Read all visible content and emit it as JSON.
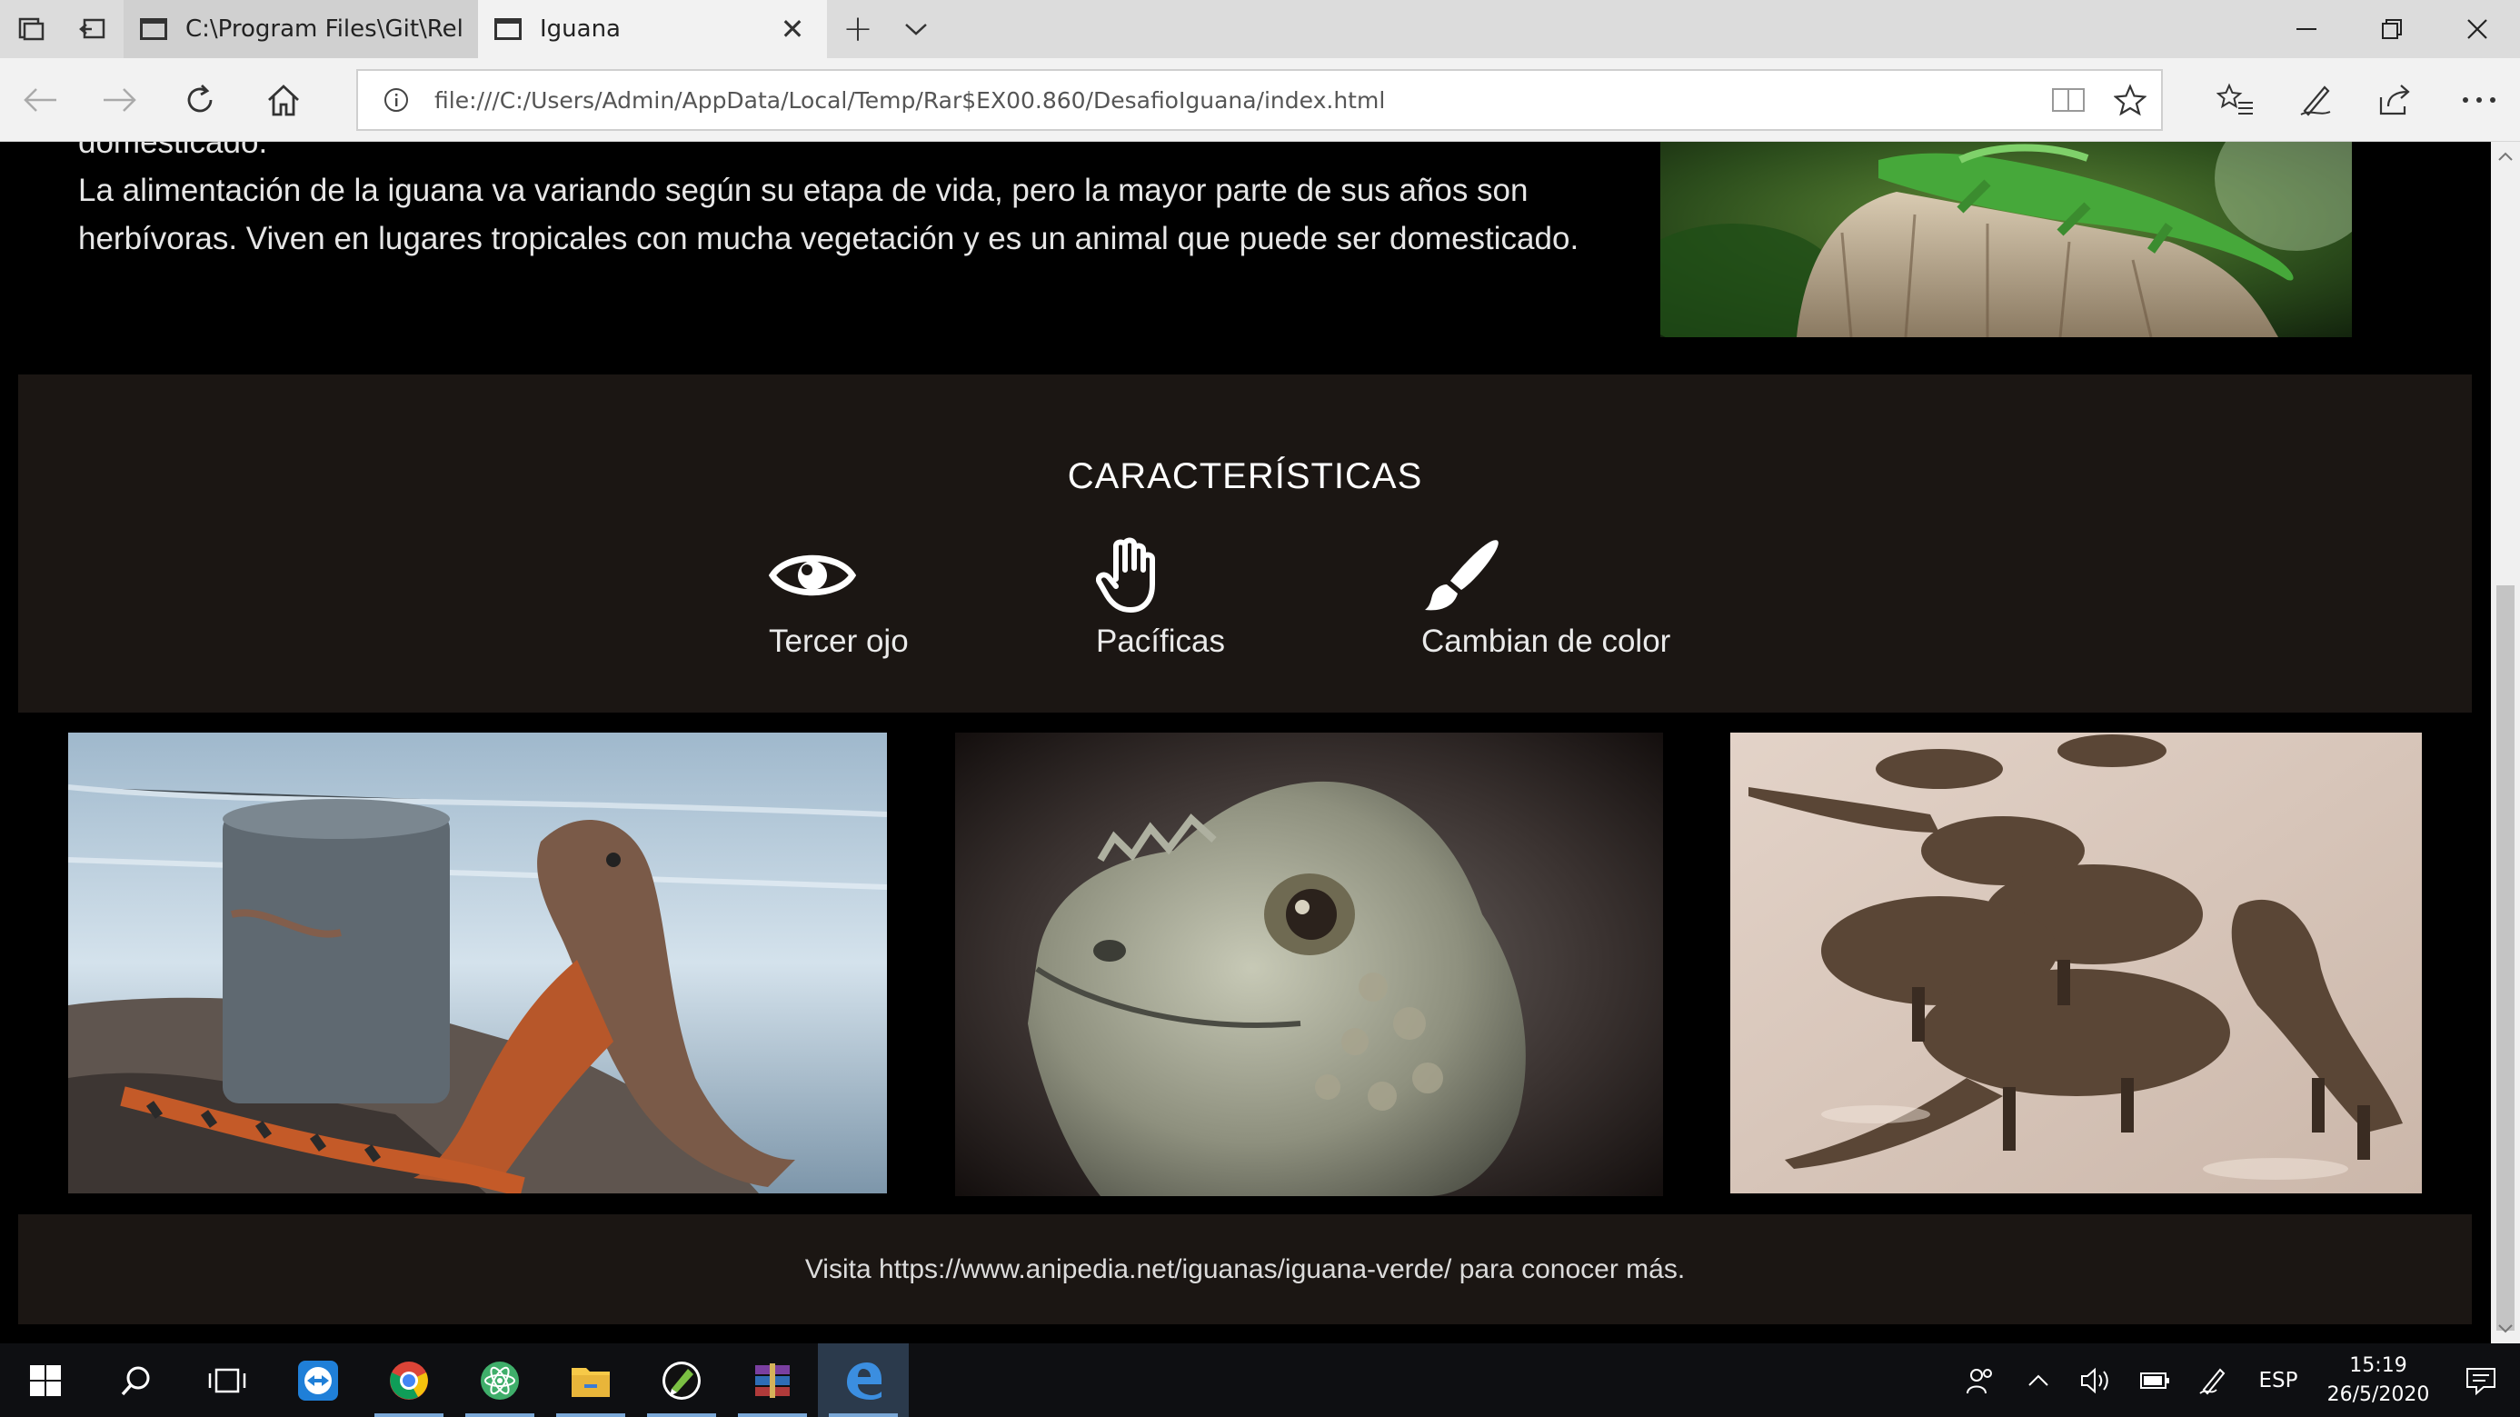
{
  "browser": {
    "tabs": [
      {
        "title": "C:\\Program Files\\Git\\Release"
      },
      {
        "title": "Iguana"
      }
    ],
    "address": "file:///C:/Users/Admin/AppData/Local/Temp/Rar$EX00.860/DesafioIguana/index.html"
  },
  "page": {
    "intro": {
      "cut_line": "domesticado.",
      "paragraph": "La alimentación de la iguana va variando según su etapa de vida, pero la mayor parte de sus años son herbívoras. Viven en lugares tropicales con mucha vegetación y es un animal que puede ser domesticado."
    },
    "features": {
      "title": "CARACTERÍSTICAS",
      "items": [
        {
          "label": "Tercer ojo",
          "icon": "eye-icon"
        },
        {
          "label": "Pacíficas",
          "icon": "hand-icon"
        },
        {
          "label": "Cambian de color",
          "icon": "paintbrush-icon"
        }
      ]
    },
    "footer": {
      "text": "Visita https://www.anipedia.net/iguanas/iguana-verde/ para conocer más."
    }
  },
  "taskbar": {
    "language": "ESP",
    "time": "15:19",
    "date": "26/5/2020"
  },
  "colors": {
    "page_bg": "#000000",
    "section_bg": "#1b1613",
    "accent": "#7aa7d6"
  }
}
